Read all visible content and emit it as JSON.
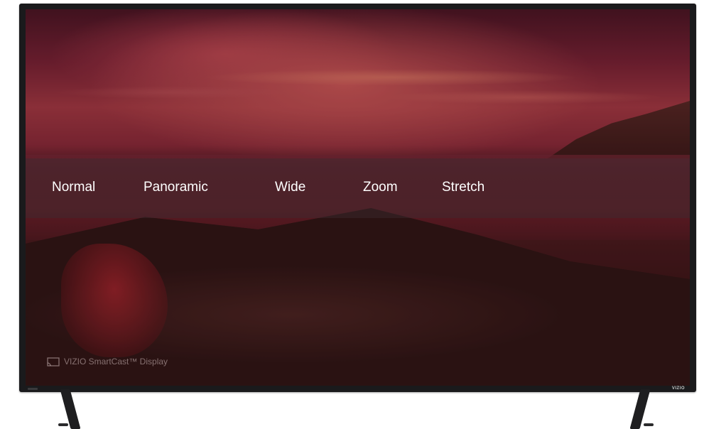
{
  "screen": {
    "aspect_menu": {
      "options": [
        "Normal",
        "Panoramic",
        "Wide",
        "Zoom",
        "Stretch"
      ]
    },
    "brand_watermark": "VIZIO SmartCast™ Display",
    "bezel_logo": "VIZIO"
  },
  "colors": {
    "menu_text": "#ffffff",
    "menu_bar_bg": "rgba(60,45,48,0.45)",
    "frame": "#1a1a1c"
  },
  "icons": {
    "cast": "cast-icon"
  }
}
